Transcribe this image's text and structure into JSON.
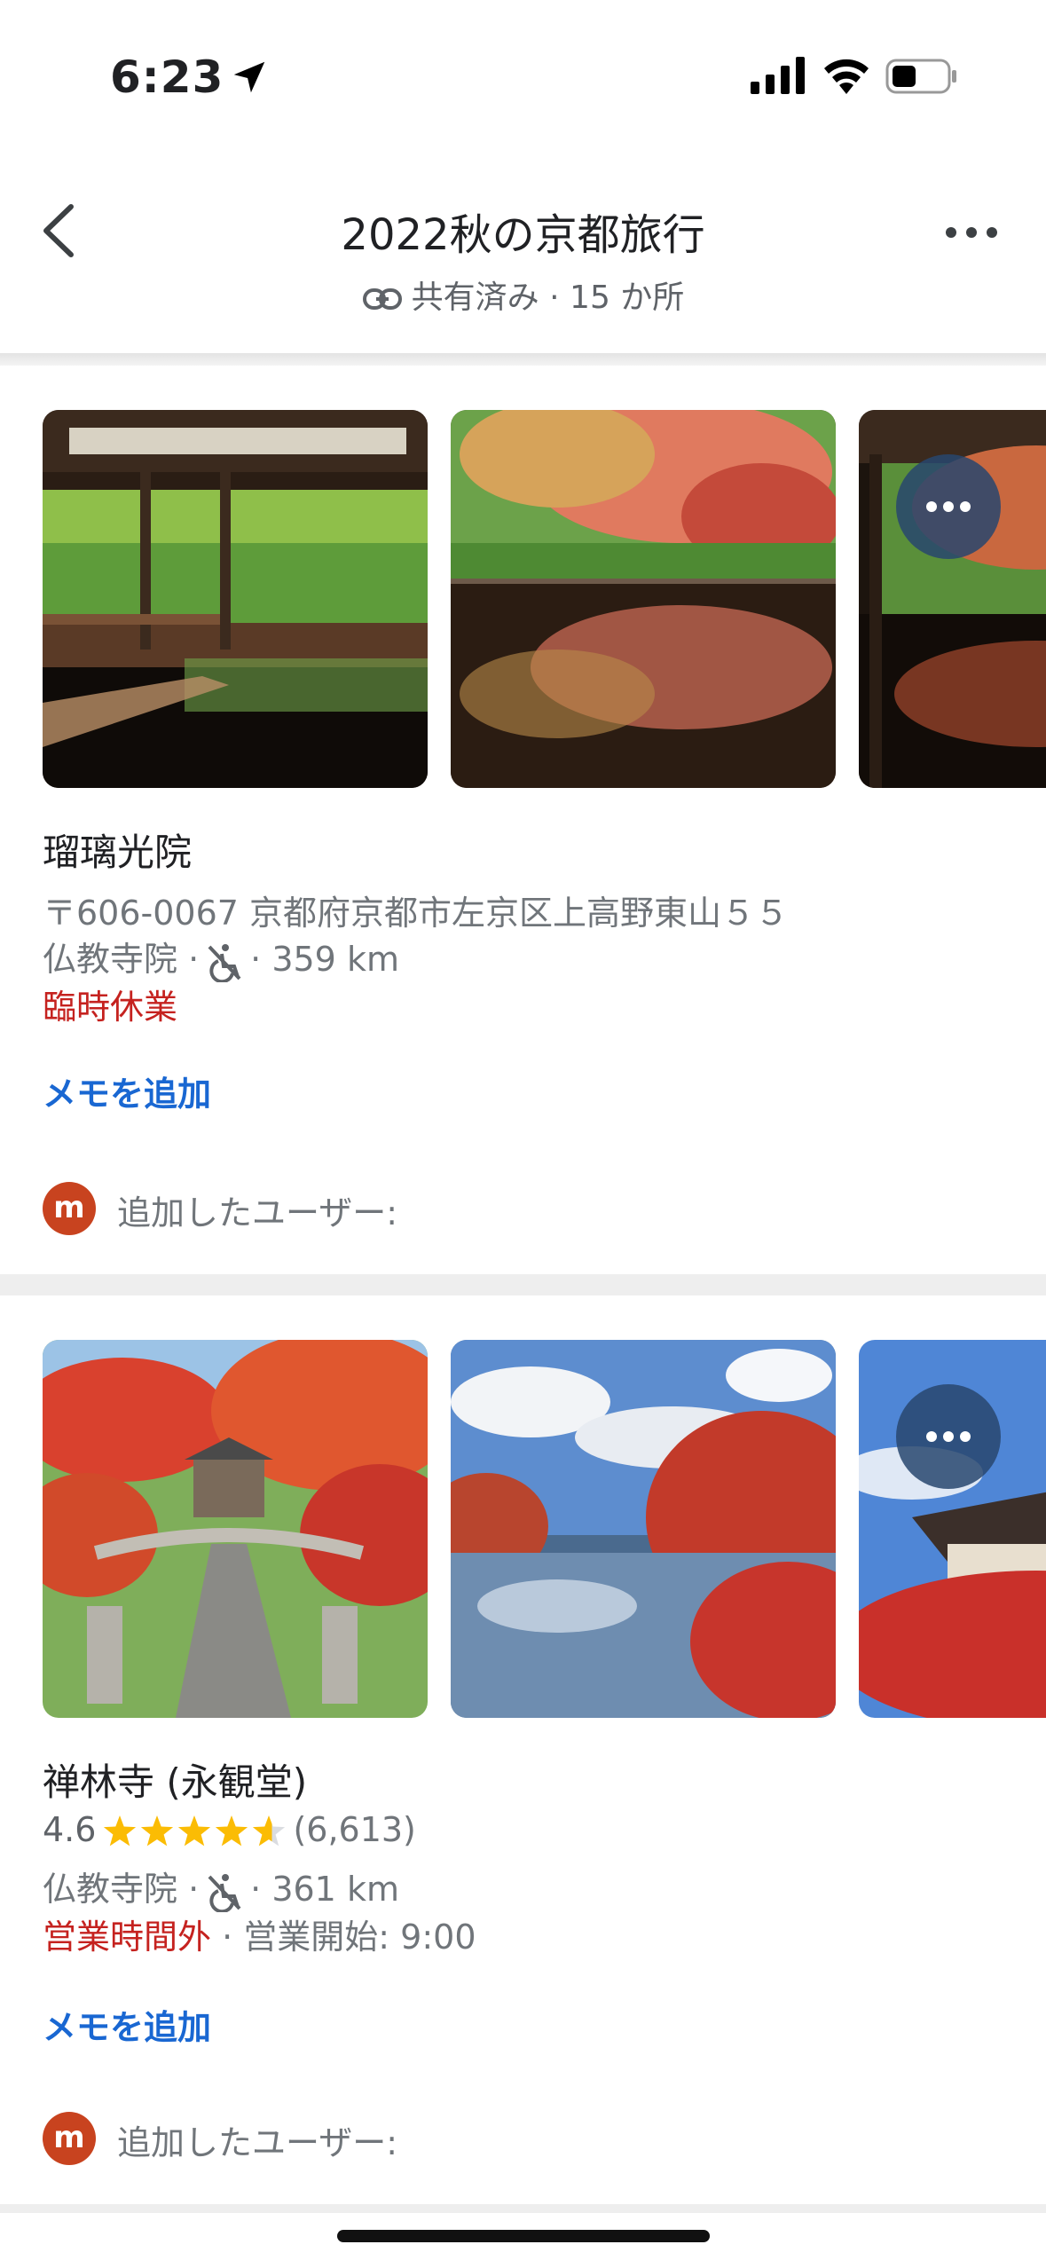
{
  "status_bar": {
    "time": "6:23",
    "icons": [
      "location-arrow-icon",
      "cellular-signal-icon",
      "wifi-icon",
      "battery-icon"
    ]
  },
  "header": {
    "title": "2022秋の京都旅行",
    "subtitle_shared": "共有済み",
    "subtitle_sep": "·",
    "subtitle_count": "15 か所",
    "icons": [
      "back-chevron-icon",
      "link-icon",
      "more-horizontal-icon"
    ]
  },
  "places": [
    {
      "name": "瑠璃光院",
      "address": "〒606-0067 京都府京都市左京区上高野東山５５",
      "category": "仏教寺院 ·",
      "distance": "· 359 km",
      "status": "臨時休業",
      "add_memo": "メモを追加",
      "avatar_letter": "m",
      "added_by": "追加したユーザー:"
    },
    {
      "name": "禅林寺 (永観堂)",
      "rating": "4.6",
      "rating_value": 4.6,
      "review_count": "(6,613)",
      "category": "仏教寺院 ·",
      "distance": "· 361 km",
      "status": "営業時間外",
      "status_sep": "·",
      "opening": "営業開始: 9:00",
      "add_memo": "メモを追加",
      "avatar_letter": "m",
      "added_by": "追加したユーザー:"
    }
  ],
  "colors": {
    "closed": "#c5221f",
    "link": "#1967d2",
    "star": "#fbbc04",
    "avatar": "#c8431f"
  }
}
